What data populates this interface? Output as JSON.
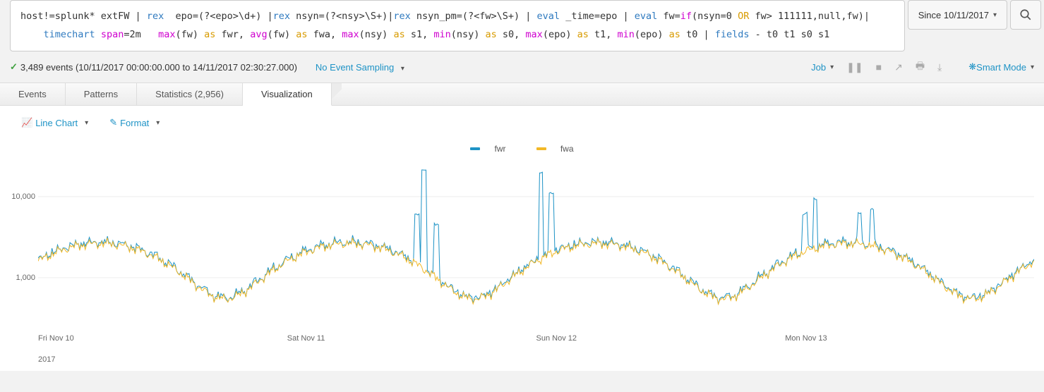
{
  "search": {
    "query_tokens": [
      {
        "t": "host!=splunk* extFW | ",
        "c": ""
      },
      {
        "t": "rex",
        "c": "tok-cmd"
      },
      {
        "t": "  epo=(?<epo>\\d+) |",
        "c": ""
      },
      {
        "t": "rex",
        "c": "tok-cmd"
      },
      {
        "t": " nsyn=(?<nsy>\\S+)|",
        "c": ""
      },
      {
        "t": "rex",
        "c": "tok-cmd"
      },
      {
        "t": " nsyn_pm=(?<fw>\\S+) | ",
        "c": ""
      },
      {
        "t": "eval",
        "c": "tok-cmd"
      },
      {
        "t": " _time=epo | ",
        "c": ""
      },
      {
        "t": "eval",
        "c": "tok-cmd"
      },
      {
        "t": " fw=",
        "c": ""
      },
      {
        "t": "if",
        "c": "tok-func"
      },
      {
        "t": "(nsyn=0 ",
        "c": ""
      },
      {
        "t": "OR",
        "c": "tok-op"
      },
      {
        "t": " fw> 111111,null,fw)|",
        "c": ""
      },
      {
        "t": "\n    ",
        "c": ""
      },
      {
        "t": "timechart",
        "c": "tok-cmd"
      },
      {
        "t": " ",
        "c": ""
      },
      {
        "t": "span",
        "c": "tok-func"
      },
      {
        "t": "=2m   ",
        "c": ""
      },
      {
        "t": "max",
        "c": "tok-func"
      },
      {
        "t": "(fw) ",
        "c": ""
      },
      {
        "t": "as",
        "c": "tok-as"
      },
      {
        "t": " fwr, ",
        "c": ""
      },
      {
        "t": "avg",
        "c": "tok-func"
      },
      {
        "t": "(fw) ",
        "c": ""
      },
      {
        "t": "as",
        "c": "tok-as"
      },
      {
        "t": " fwa, ",
        "c": ""
      },
      {
        "t": "max",
        "c": "tok-func"
      },
      {
        "t": "(nsy) ",
        "c": ""
      },
      {
        "t": "as",
        "c": "tok-as"
      },
      {
        "t": " s1, ",
        "c": ""
      },
      {
        "t": "min",
        "c": "tok-func"
      },
      {
        "t": "(nsy) ",
        "c": ""
      },
      {
        "t": "as",
        "c": "tok-as"
      },
      {
        "t": " s0, ",
        "c": ""
      },
      {
        "t": "max",
        "c": "tok-func"
      },
      {
        "t": "(epo) ",
        "c": ""
      },
      {
        "t": "as",
        "c": "tok-as"
      },
      {
        "t": " t1, ",
        "c": ""
      },
      {
        "t": "min",
        "c": "tok-func"
      },
      {
        "t": "(epo) ",
        "c": ""
      },
      {
        "t": "as",
        "c": "tok-as"
      },
      {
        "t": " t0 | ",
        "c": ""
      },
      {
        "t": "fields",
        "c": "tok-cmd"
      },
      {
        "t": " - t0 t1 s0 s1",
        "c": ""
      }
    ],
    "time_range": "Since 10/11/2017"
  },
  "status": {
    "events_text": "3,489 events (10/11/2017 00:00:00.000 to 14/11/2017 02:30:27.000)",
    "sampling": "No Event Sampling",
    "job": "Job",
    "smart": "Smart Mode"
  },
  "tabs": {
    "events": "Events",
    "patterns": "Patterns",
    "statistics": "Statistics (2,956)",
    "visualization": "Visualization"
  },
  "viz": {
    "chart_type": "Line Chart",
    "format": "Format"
  },
  "legend": {
    "a": "fwr",
    "b": "fwa"
  },
  "axes": {
    "y_ticks": [
      {
        "label": "1,000",
        "value": 1000
      },
      {
        "label": "10,000",
        "value": 10000
      }
    ],
    "x_ticks": [
      "Fri Nov 10",
      "Sat Nov 11",
      "Sun Nov 12",
      "Mon Nov 13"
    ],
    "year": "2017"
  },
  "chart_data": {
    "type": "line",
    "title": "",
    "xlabel": "",
    "ylabel": "",
    "ylim_log": [
      300,
      30000
    ],
    "x_range_days": [
      "2017-11-10",
      "2017-11-14"
    ],
    "n_points": 2956,
    "series": [
      {
        "name": "fwr",
        "color": "#1e93c6"
      },
      {
        "name": "fwa",
        "color": "#f2b827"
      }
    ],
    "note": "Both series follow a near-identical diurnal cycle: troughs ≈600–700 around 06:00 each day, peaks ≈2,500–3,000 around 18:00. fwr (max) shows occasional narrow spikes to 8,000–20,000 on Nov 11 afternoon and Nov 12 early morning, and one spike ≈7,000 on Nov 13 morning. fwa (avg) tracks fwr closely but slightly lower and without the tallest spikes."
  }
}
